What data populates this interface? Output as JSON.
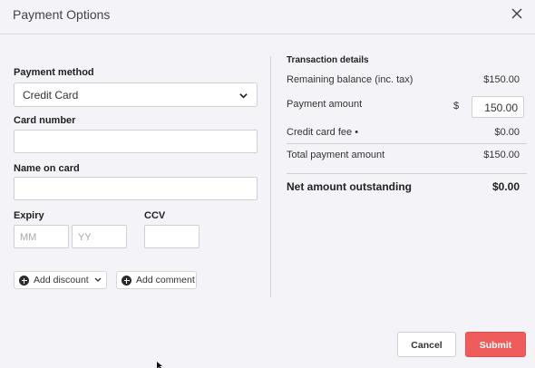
{
  "modal": {
    "title": "Payment Options"
  },
  "form": {
    "payment_method_label": "Payment method",
    "payment_method_value": "Credit Card",
    "card_number_label": "Card number",
    "card_number_value": "",
    "name_on_card_label": "Name on card",
    "name_on_card_value": "",
    "expiry_label": "Expiry",
    "expiry_month_placeholder": "MM",
    "expiry_year_placeholder": "YY",
    "ccv_label": "CCV",
    "ccv_value": "",
    "add_discount_label": "Add discount",
    "add_comment_label": "Add comment"
  },
  "transaction": {
    "title": "Transaction details",
    "rows": [
      {
        "label": "Remaining balance (inc. tax)",
        "value": "$150.00"
      },
      {
        "label": "Payment amount",
        "currency": "$",
        "value": "150.00"
      },
      {
        "label": "Credit card fee •",
        "value": "$0.00"
      },
      {
        "label": "Total payment amount",
        "value": "$150.00"
      }
    ],
    "net_label": "Net amount outstanding",
    "net_value": "$0.00"
  },
  "footer": {
    "cancel_label": "Cancel",
    "submit_label": "Submit"
  },
  "colors": {
    "background": "#f4f3f7",
    "submit": "#ee5c5c"
  },
  "icons": [
    "close-icon",
    "chevron-down-icon",
    "plus-circle-icon",
    "cursor-icon"
  ]
}
